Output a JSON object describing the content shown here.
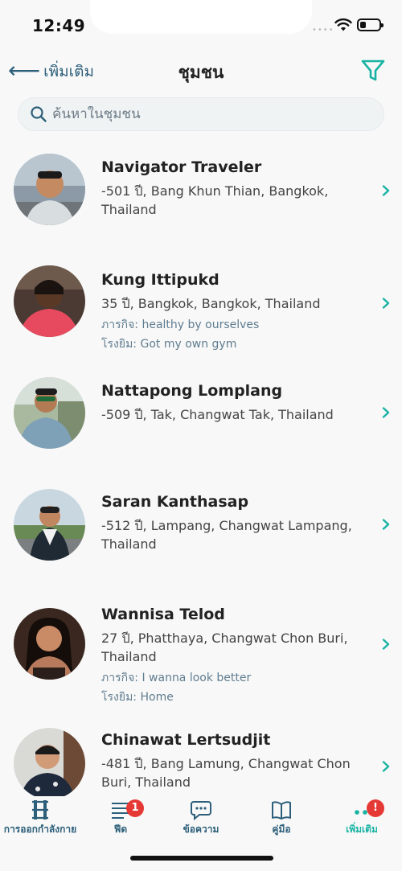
{
  "status_bar": {
    "time": "12:49",
    "signal": "••••"
  },
  "header": {
    "back_label": "เพิ่มเติม",
    "back_arrow": "⟵",
    "title": "ชุมชน",
    "accent_color": "#19b3a3"
  },
  "search": {
    "placeholder": "ค้นหาในชุมชน"
  },
  "members": [
    {
      "name": "Navigator Traveler",
      "location": "-501 ปี, Bang Khun Thian, Bangkok, Thailand"
    },
    {
      "name": "Kung Ittipukd",
      "location": "35 ปี, Bangkok, Bangkok, Thailand",
      "mission": "ภารกิจ: healthy by ourselves",
      "gym": "โรงยิม: Got my own gym"
    },
    {
      "name": "Nattapong Lomplang",
      "location": "-509 ปี, Tak, Changwat Tak, Thailand"
    },
    {
      "name": "Saran Kanthasap",
      "location": "-512 ปี, Lampang, Changwat Lampang, Thailand"
    },
    {
      "name": "Wannisa Telod",
      "location": "27 ปี, Phatthaya, Changwat Chon Buri, Thailand",
      "mission": "ภารกิจ: I wanna look better",
      "gym": "โรงยิม: Home"
    },
    {
      "name": "Chinawat Lertsudjit",
      "location": "-481 ปี, Bang Lamung, Changwat Chon Buri, Thailand"
    }
  ],
  "nav": {
    "workout": {
      "label": "การออกกำลังกาย",
      "icon": "dumbbell-icon"
    },
    "feed": {
      "label": "ฟีด",
      "icon": "feed-icon",
      "badge": "1"
    },
    "messages": {
      "label": "ข้อความ",
      "icon": "chat-icon"
    },
    "guide": {
      "label": "คู่มือ",
      "icon": "book-icon"
    },
    "more": {
      "label": "เพิ่มเติม",
      "icon": "more-icon",
      "badge": "!"
    }
  }
}
